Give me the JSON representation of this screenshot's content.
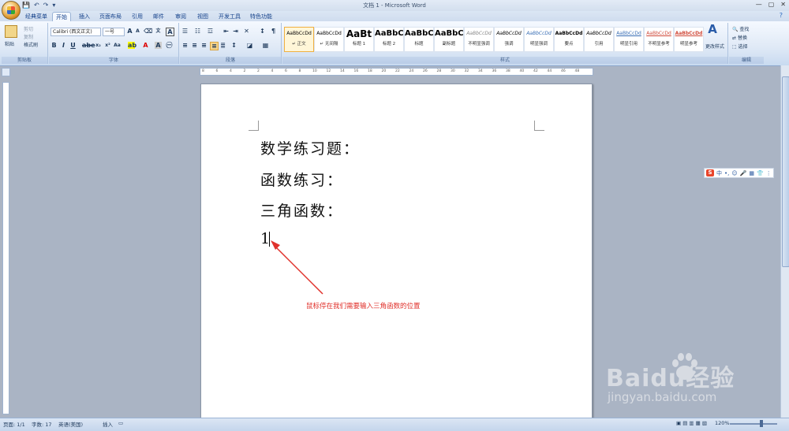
{
  "window": {
    "title": "文档 1 - Microsoft Word",
    "quick_access": [
      "💾",
      "↶",
      "↷",
      "▾"
    ]
  },
  "tabs": [
    {
      "label": "经典菜单"
    },
    {
      "label": "开始"
    },
    {
      "label": "插入"
    },
    {
      "label": "页面布局"
    },
    {
      "label": "引用"
    },
    {
      "label": "邮件"
    },
    {
      "label": "审阅"
    },
    {
      "label": "视图"
    },
    {
      "label": "开发工具"
    },
    {
      "label": "特色功能"
    }
  ],
  "ribbon": {
    "clipboard": {
      "label": "剪贴板",
      "paste": "粘贴",
      "cut": "剪切",
      "copy": "复制",
      "format_painter": "格式刷"
    },
    "font": {
      "label": "字体",
      "font_name": "Calibri (西文正文)",
      "font_size": "一号"
    },
    "paragraph": {
      "label": "段落"
    },
    "styles": {
      "label": "样式",
      "items": [
        {
          "sample": "AaBbCcDd",
          "name": "↵ 正文"
        },
        {
          "sample": "AaBbCcDd",
          "name": "↵ 无间隔"
        },
        {
          "sample": "AaBt",
          "name": "标题 1"
        },
        {
          "sample": "AaBbC",
          "name": "标题 2"
        },
        {
          "sample": "AaBbC",
          "name": "标题"
        },
        {
          "sample": "AaBbC",
          "name": "副标题"
        },
        {
          "sample": "AaBbCcDd",
          "name": "不明显强调"
        },
        {
          "sample": "AaBbCcDd",
          "name": "强调"
        },
        {
          "sample": "AaBbCcDd",
          "name": "明显强调"
        },
        {
          "sample": "AaBbCcDd",
          "name": "要点"
        },
        {
          "sample": "AaBbCcDd",
          "name": "引用"
        },
        {
          "sample": "AaBbCcDd",
          "name": "明显引用"
        },
        {
          "sample": "AaBbCcDd",
          "name": "不明显参考"
        },
        {
          "sample": "AaBbCcDd",
          "name": "明显参考"
        }
      ],
      "change_styles": "更改样式"
    },
    "editing": {
      "label": "编辑",
      "find": "查找",
      "replace": "替换",
      "select": "选择"
    }
  },
  "document": {
    "lines": [
      "数学练习题：",
      "函数练习：",
      "三角函数：",
      "1"
    ],
    "annotation": "鼠标停在我们需要输入三角函数的位置"
  },
  "ruler_marks": [
    "8",
    "6",
    "4",
    "2",
    "2",
    "4",
    "6",
    "8",
    "10",
    "12",
    "14",
    "16",
    "18",
    "20",
    "22",
    "24",
    "26",
    "28",
    "30",
    "32",
    "34",
    "36",
    "38",
    "40",
    "42",
    "44",
    "46",
    "48"
  ],
  "status": {
    "page": "页面: 1/1",
    "words": "字数: 17",
    "language": "英语(美国)",
    "insert_mode": "插入",
    "zoom": "120%"
  },
  "ime": {
    "items": [
      "中",
      "•,",
      "☺",
      "🎤",
      "▦",
      "👕",
      "⋮"
    ]
  },
  "watermark": {
    "text": "Baidu经验",
    "url": "jingyan.baidu.com"
  },
  "colors": {
    "annotation": "#e0312b",
    "ribbon_text": "#15428b"
  }
}
